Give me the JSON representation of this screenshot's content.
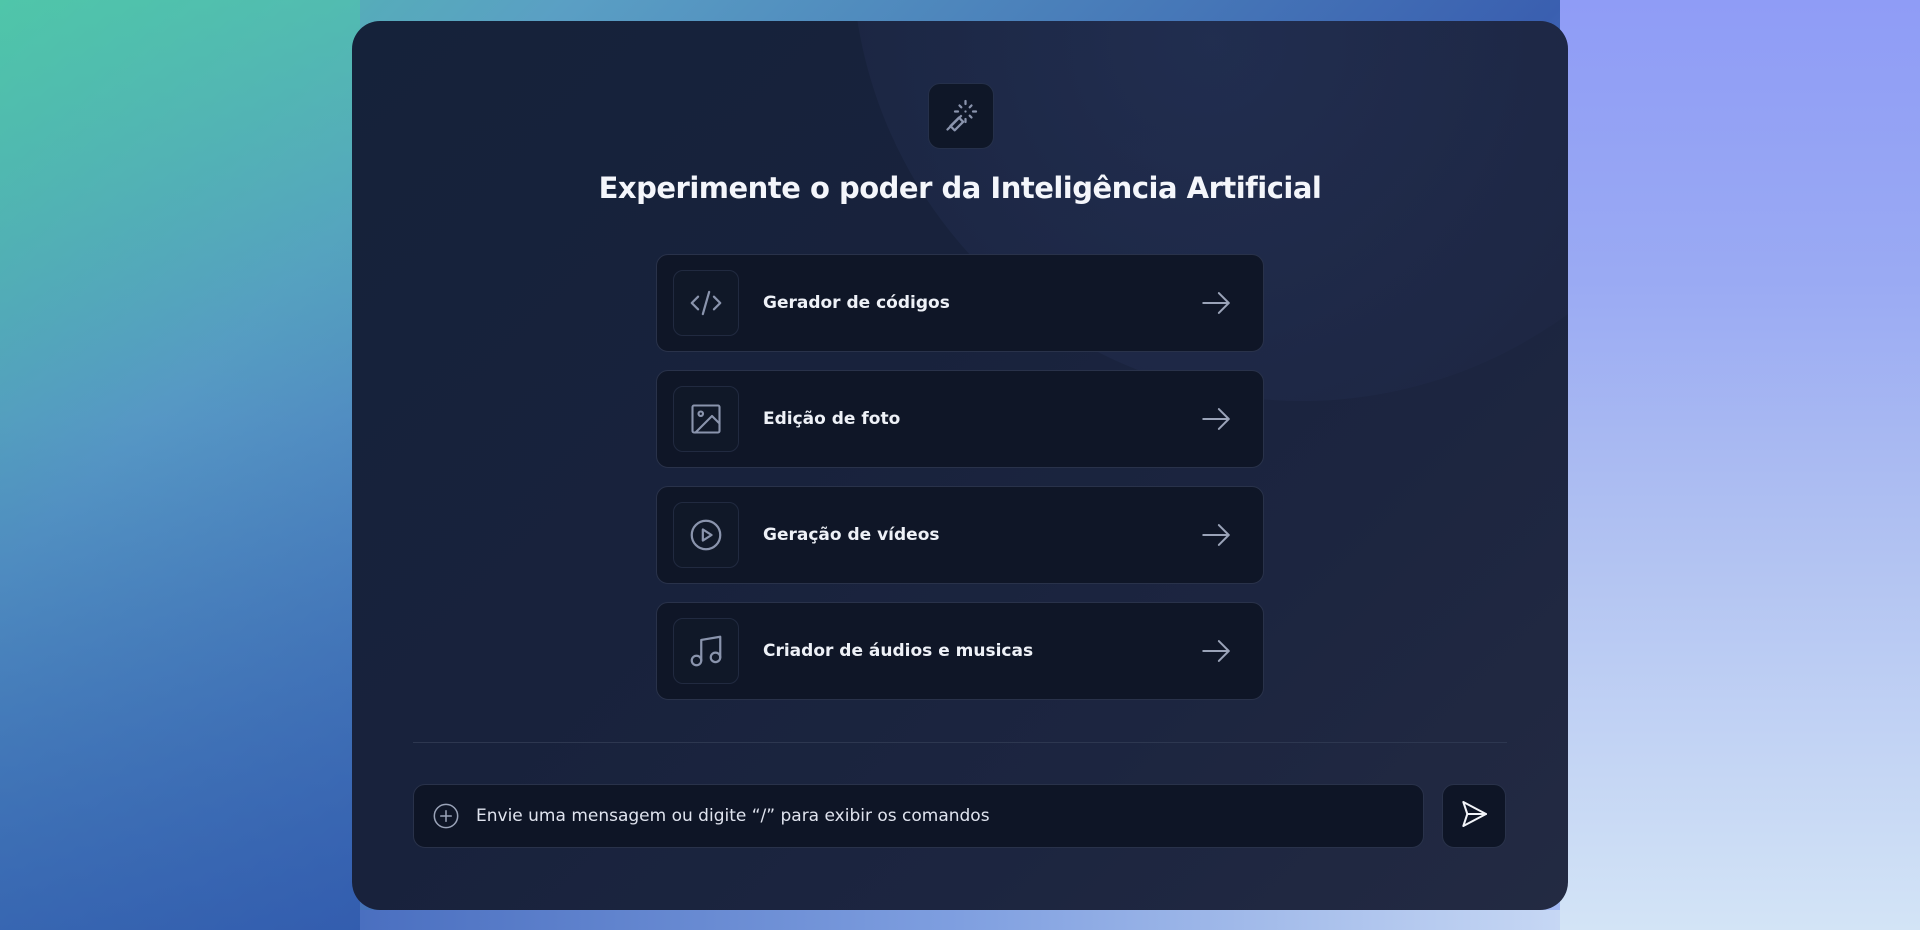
{
  "page": {
    "title": "Experimente o poder da Inteligência Artificial",
    "logo_icon": "magic-wand-icon"
  },
  "options": [
    {
      "label": "Gerador de códigos",
      "icon": "code-icon"
    },
    {
      "label": "Edição de foto",
      "icon": "image-icon"
    },
    {
      "label": "Geração de vídeos",
      "icon": "play-circle-icon"
    },
    {
      "label": "Criador de áudios e musicas",
      "icon": "music-note-icon"
    }
  ],
  "composer": {
    "placeholder": "Envie uma mensagem ou digite “/” para exibir os comandos",
    "value": "",
    "attach_icon": "plus-circle-icon",
    "send_icon": "send-icon"
  },
  "colors": {
    "card_bg": "#18223c",
    "option_bg": "#0f1627",
    "border": "#29324a",
    "text": "#eef1f7",
    "icon_stroke": "#8a94ad"
  }
}
